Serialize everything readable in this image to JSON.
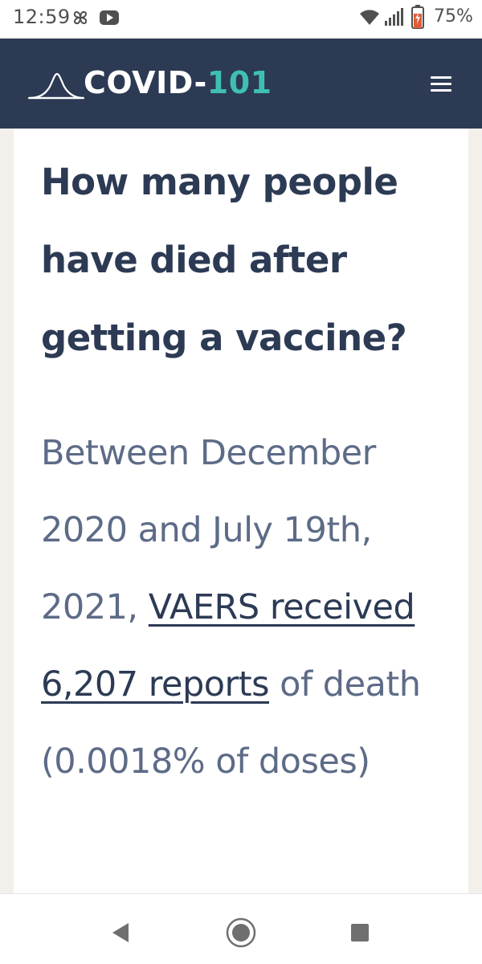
{
  "status_bar": {
    "time": "12:59",
    "battery_percent": "75%",
    "battery_level": 0.75,
    "battery_color": "#e15c3a",
    "icons": [
      "pinwheel-icon",
      "youtube-icon",
      "wifi-icon",
      "signal-icon",
      "battery-icon"
    ]
  },
  "header": {
    "logo_word_1": "COVID-",
    "logo_word_2": "101",
    "logo_icon": "bell-curve-icon",
    "menu_icon": "hamburger-menu-icon",
    "background_color": "#2c3a54",
    "accent_color": "#3fbfb2"
  },
  "article": {
    "heading": "How many people have died after getting a vaccine?",
    "body_before_link": "Between December 2020 and July 19th, 2021, ",
    "link_text": "VAERS received 6,207 reports",
    "body_after_link": " of death (0.0018% of doses)",
    "heading_color": "#2c3a54",
    "body_color": "#5d6b87"
  },
  "nav_bar": {
    "icons": [
      "back-icon",
      "home-icon",
      "recents-icon"
    ]
  }
}
